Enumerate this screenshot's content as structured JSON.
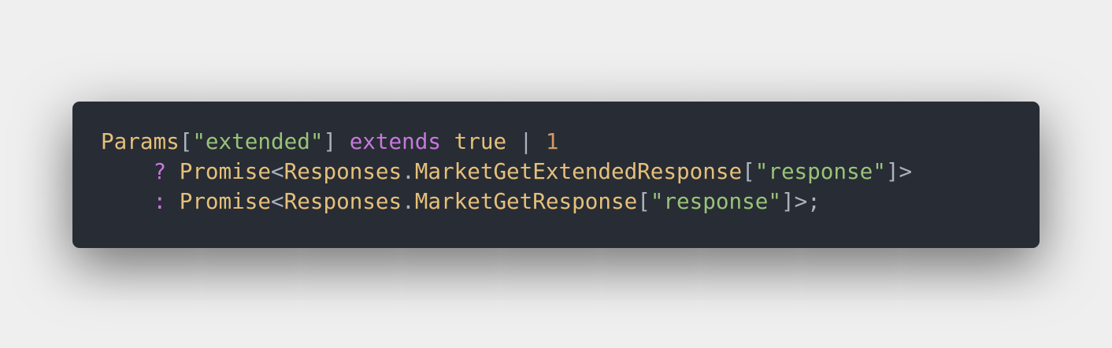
{
  "code_block": {
    "language": "typescript",
    "colors": {
      "background": "#282c34",
      "type": "#e5c07b",
      "string": "#98c379",
      "keyword": "#c678dd",
      "number": "#d19a66",
      "punctuation": "#abb2bf"
    },
    "lines": [
      {
        "tokens": [
          {
            "text": "Params",
            "kind": "type"
          },
          {
            "text": "[",
            "kind": "punc"
          },
          {
            "text": "\"extended\"",
            "kind": "str"
          },
          {
            "text": "] ",
            "kind": "punc"
          },
          {
            "text": "extends",
            "kind": "kw"
          },
          {
            "text": " ",
            "kind": "punc"
          },
          {
            "text": "true",
            "kind": "type"
          },
          {
            "text": " | ",
            "kind": "punc"
          },
          {
            "text": "1",
            "kind": "num"
          }
        ]
      },
      {
        "tokens": [
          {
            "text": "    ",
            "kind": "punc"
          },
          {
            "text": "?",
            "kind": "kw"
          },
          {
            "text": " ",
            "kind": "punc"
          },
          {
            "text": "Promise",
            "kind": "type"
          },
          {
            "text": "<",
            "kind": "punc"
          },
          {
            "text": "Responses",
            "kind": "type"
          },
          {
            "text": ".",
            "kind": "punc"
          },
          {
            "text": "MarketGetExtendedResponse",
            "kind": "type"
          },
          {
            "text": "[",
            "kind": "punc"
          },
          {
            "text": "\"response\"",
            "kind": "str"
          },
          {
            "text": "]>",
            "kind": "punc"
          }
        ]
      },
      {
        "tokens": [
          {
            "text": "    ",
            "kind": "punc"
          },
          {
            "text": ":",
            "kind": "kw"
          },
          {
            "text": " ",
            "kind": "punc"
          },
          {
            "text": "Promise",
            "kind": "type"
          },
          {
            "text": "<",
            "kind": "punc"
          },
          {
            "text": "Responses",
            "kind": "type"
          },
          {
            "text": ".",
            "kind": "punc"
          },
          {
            "text": "MarketGetResponse",
            "kind": "type"
          },
          {
            "text": "[",
            "kind": "punc"
          },
          {
            "text": "\"response\"",
            "kind": "str"
          },
          {
            "text": "]>;",
            "kind": "punc"
          }
        ]
      }
    ]
  }
}
